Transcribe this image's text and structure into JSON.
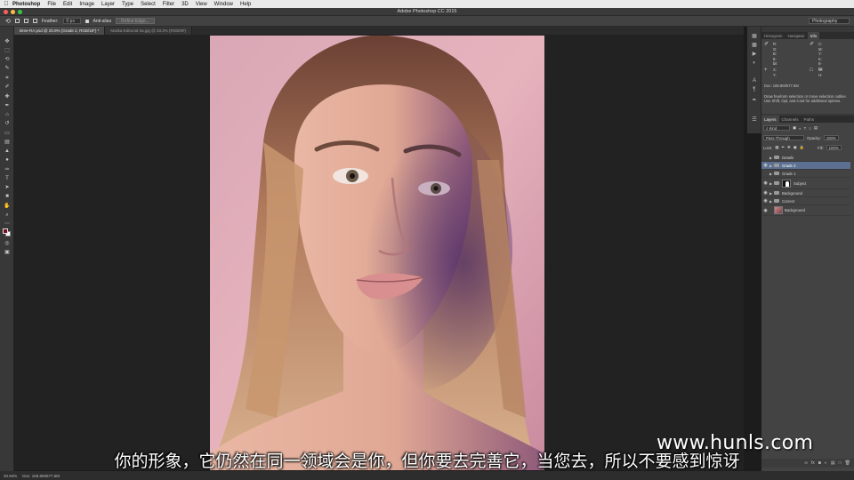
{
  "menubar": {
    "app_name": "Photoshop",
    "items": [
      "File",
      "Edit",
      "Image",
      "Layer",
      "Type",
      "Select",
      "Filter",
      "3D",
      "View",
      "Window",
      "Help"
    ]
  },
  "window": {
    "title": "Adobe Photoshop CC 2015"
  },
  "options": {
    "feather_label": "Feather:",
    "feather_value": "0 px",
    "antialias_label": "Anti-alias",
    "refine_edge_label": "Refine Edge...",
    "workspace": "Photography"
  },
  "tabs": [
    {
      "label": "Bree-RA.psd @ 20.9% (Grade 2, RGB/16*) *"
    },
    {
      "label": "Malika-Editorial-3a.jpg @ 33.3% (RGB/8#)"
    }
  ],
  "info_panel": {
    "tabs": [
      "Histogram",
      "Navigator",
      "Info"
    ],
    "rgb": [
      "R:",
      "G:",
      "B:",
      "8-bit"
    ],
    "cmyk": [
      "C:",
      "M:",
      "Y:",
      "K:",
      "8-bit"
    ],
    "xy": [
      "X:",
      "Y:"
    ],
    "wh": [
      "W:",
      "H:"
    ],
    "doc_size": "Doc: 169.8M/677.6M",
    "help_text": "Draw freeform selection or move selection outline. Use Shift, Opt, and Cmd for additional options."
  },
  "layers_panel": {
    "tabs": [
      "Layers",
      "Channels",
      "Paths"
    ],
    "filter_kind": "Kind",
    "blend_mode": "Pass Through",
    "opacity_label": "Opacity:",
    "opacity_value": "100%",
    "lock_label": "Lock:",
    "fill_label": "Fill:",
    "fill_value": "100%",
    "layers": [
      {
        "name": "Details",
        "type": "group",
        "visible": false,
        "selected": false
      },
      {
        "name": "Grade 2",
        "type": "group",
        "visible": true,
        "selected": true
      },
      {
        "name": "Grade 1",
        "type": "group",
        "visible": false,
        "selected": false
      },
      {
        "name": "Subject",
        "type": "group-mask",
        "visible": true,
        "selected": false
      },
      {
        "name": "Background",
        "type": "group",
        "visible": true,
        "selected": false
      },
      {
        "name": "Correct",
        "type": "group",
        "visible": true,
        "selected": false
      },
      {
        "name": "Background",
        "type": "image",
        "visible": true,
        "selected": false
      }
    ]
  },
  "status": {
    "zoom": "20.94%",
    "doc": "Doc: 169.8M/677.6M"
  },
  "colors": {
    "foreground": "#7a1020",
    "background": "#ffffff",
    "selection": "#5c7191"
  },
  "subtitle": "你的形象，它仍然在同一领域会是你，但你要去完善它，当您去，所以不要感到惊讶",
  "watermark": "www.hunls.com"
}
